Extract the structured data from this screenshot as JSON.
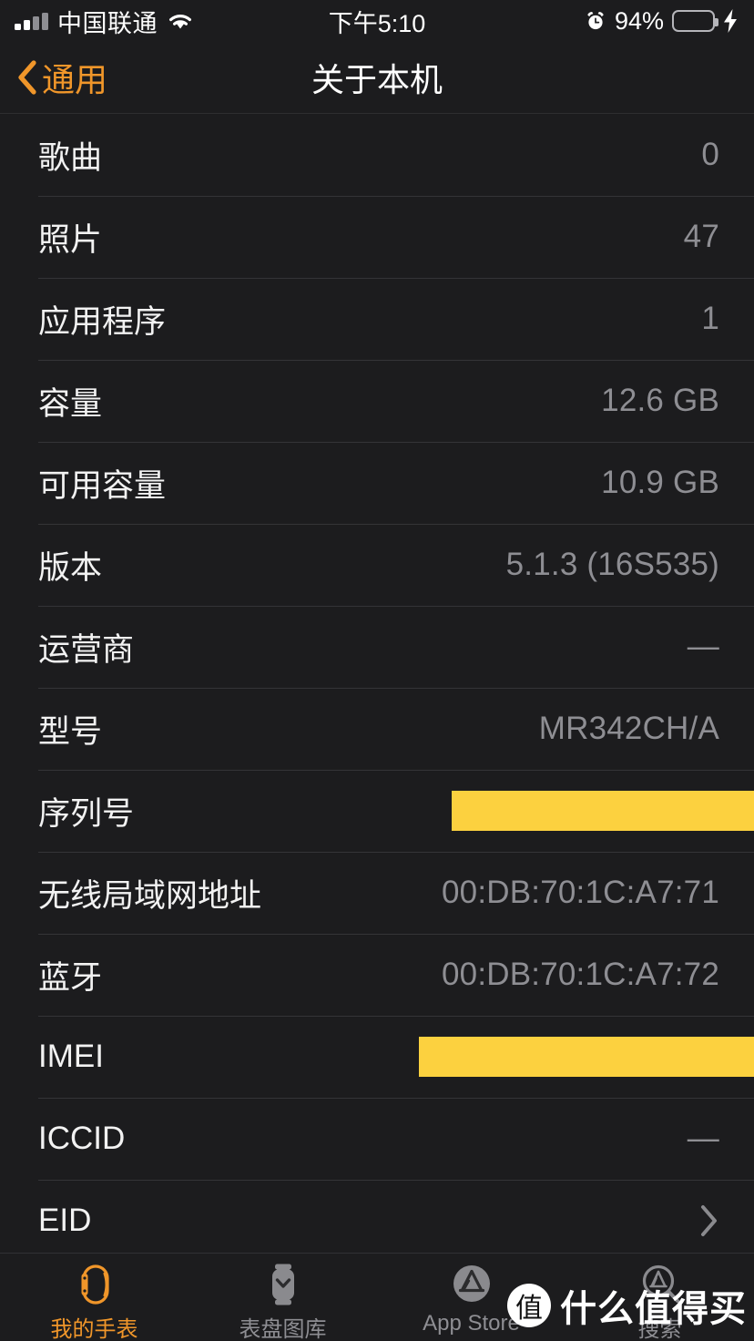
{
  "status_bar": {
    "carrier": "中国联通",
    "wifi_icon": "wifi-icon",
    "time": "下午5:10",
    "alarm_icon": "alarm-clock-icon",
    "battery_percent": "94%",
    "battery_level": 94,
    "charging_icon": "lightning-bolt-icon",
    "battery_color": "#3cd845"
  },
  "nav_bar": {
    "back_label": "通用",
    "back_icon": "chevron-left-icon",
    "title": "关于本机",
    "accent_color": "#f0962a"
  },
  "list": {
    "rows": [
      {
        "label": "歌曲",
        "value": "0",
        "type": "value"
      },
      {
        "label": "照片",
        "value": "47",
        "type": "value"
      },
      {
        "label": "应用程序",
        "value": "1",
        "type": "value"
      },
      {
        "label": "容量",
        "value": "12.6 GB",
        "type": "value"
      },
      {
        "label": "可用容量",
        "value": "10.9 GB",
        "type": "value"
      },
      {
        "label": "版本",
        "value": "5.1.3 (16S535)",
        "type": "value"
      },
      {
        "label": "运营商",
        "value": "—",
        "type": "value"
      },
      {
        "label": "型号",
        "value": "MR342CH/A",
        "type": "value"
      },
      {
        "label": "序列号",
        "value": "",
        "type": "redacted"
      },
      {
        "label": "无线局域网地址",
        "value": "00:DB:70:1C:A7:71",
        "type": "value"
      },
      {
        "label": "蓝牙",
        "value": "00:DB:70:1C:A7:72",
        "type": "value"
      },
      {
        "label": "IMEI",
        "value": "",
        "type": "redacted"
      },
      {
        "label": "ICCID",
        "value": "—",
        "type": "value"
      },
      {
        "label": "EID",
        "value": "",
        "type": "disclosure"
      }
    ],
    "redaction_color": "#fcd13f"
  },
  "tab_bar": {
    "tabs": [
      {
        "label": "我的手表",
        "icon": "watch-outline-icon",
        "active": true
      },
      {
        "label": "表盘图库",
        "icon": "watch-face-gallery-icon",
        "active": false
      },
      {
        "label": "App Store",
        "icon": "app-store-icon",
        "active": false
      },
      {
        "label": "搜索",
        "icon": "app-store-search-icon",
        "active": false
      }
    ]
  },
  "watermark": {
    "badge": "值",
    "text": "什么值得买"
  }
}
